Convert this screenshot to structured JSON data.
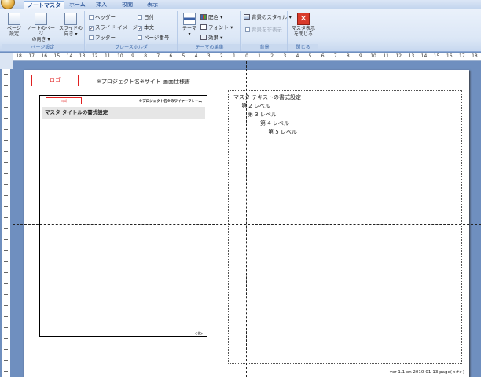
{
  "tabs": [
    {
      "label": "ノートマスタ",
      "active": true
    },
    {
      "label": "ホーム",
      "active": false
    },
    {
      "label": "挿入",
      "active": false
    },
    {
      "label": "校閲",
      "active": false
    },
    {
      "label": "表示",
      "active": false
    }
  ],
  "ribbon": {
    "page_setup": {
      "group_label": "ページ設定",
      "buttons": [
        {
          "label_line1": "ページ",
          "label_line2": "設定"
        },
        {
          "label_line1": "ノートのページ",
          "label_line2": "の向き ▾"
        },
        {
          "label_line1": "スライドの",
          "label_line2": "向き ▾"
        }
      ]
    },
    "placeholders": {
      "group_label": "プレースホルダ",
      "items": [
        {
          "label": "ヘッダー",
          "checked": false
        },
        {
          "label": "スライド イメージ",
          "checked": true
        },
        {
          "label": "フッター",
          "checked": false
        },
        {
          "label": "日付",
          "checked": false
        },
        {
          "label": "本文",
          "checked": true
        },
        {
          "label": "ページ番号",
          "checked": false
        }
      ]
    },
    "theme": {
      "group_label": "テーマの編集",
      "theme_button": {
        "label_line1": "テーマ",
        "label_line2": "▾"
      },
      "colors": "配色 ▾",
      "fonts": "フォント ▾",
      "effects": "効果 ▾"
    },
    "background": {
      "group_label": "背景",
      "bg_styles": "背景のスタイル ▾",
      "hide_bg": "背景を非表示"
    },
    "close": {
      "group_label": "閉じる",
      "label_line1": "マスタ表示",
      "label_line2": "を閉じる"
    }
  },
  "ruler": {
    "h_labels": [
      "18",
      "17",
      "16",
      "15",
      "14",
      "13",
      "12",
      "11",
      "10",
      "9",
      "8",
      "7",
      "6",
      "5",
      "4",
      "3",
      "2",
      "1",
      "0",
      "1",
      "2",
      "3",
      "4",
      "5",
      "6",
      "7",
      "8",
      "9",
      "10",
      "11",
      "12",
      "13",
      "14",
      "15",
      "16",
      "17",
      "18"
    ]
  },
  "page": {
    "logo": "ロゴ",
    "project": "※プロジェクト名※サイト 画面仕様書",
    "thumb": {
      "logo": "ロゴ",
      "project": "※プロジェクト名※のワイヤーフレーム",
      "title": "マスタ タイトルの書式設定",
      "num": "<#>"
    },
    "notes_levels": [
      "マスタ テキストの書式設定",
      "第 2 レベル",
      "第 3 レベル",
      "第 4 レベル",
      "第 5 レベル"
    ],
    "footer": "ver 1.1 on 2010-01-13 page(<#>)"
  },
  "colors": {
    "accent": "#15428b",
    "logo_red": "#e02020",
    "close_red": "#d93a2b"
  }
}
